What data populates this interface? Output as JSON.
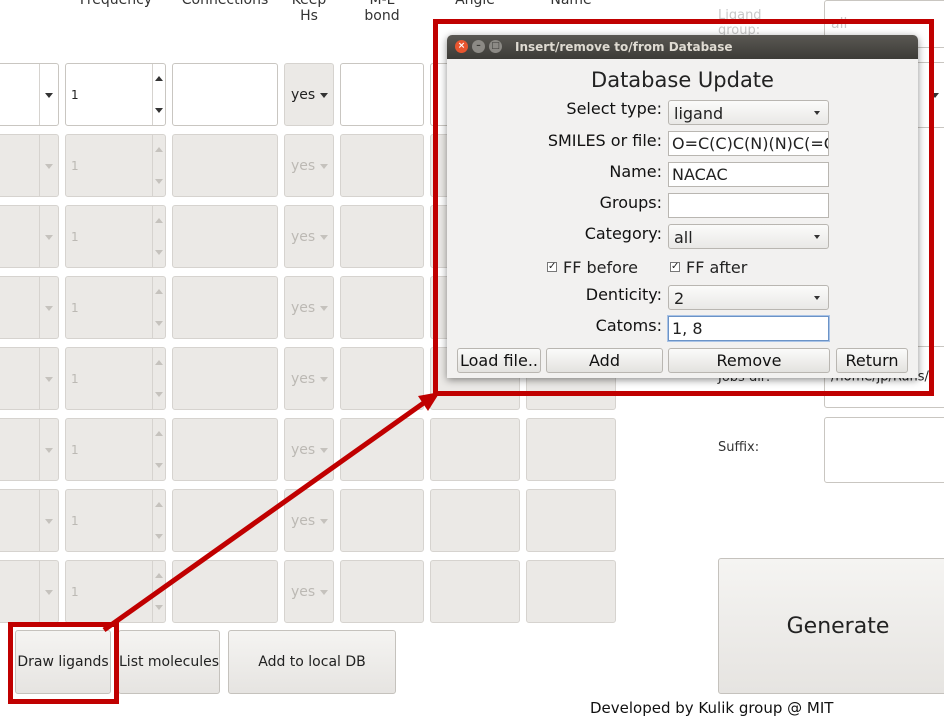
{
  "table": {
    "headers": {
      "frequency": "Frequency",
      "connections": "Connections",
      "keep_hs_line1": "Keep",
      "keep_hs_line2": "Hs",
      "ml_bond_line1": "M-L",
      "ml_bond_line2": "bond",
      "angle": "Angle",
      "name": "Name"
    },
    "rows": [
      {
        "frequency": "1",
        "keep_hs": "yes"
      },
      {
        "frequency": "1",
        "keep_hs": "yes"
      },
      {
        "frequency": "1",
        "keep_hs": "yes"
      },
      {
        "frequency": "1",
        "keep_hs": "yes"
      },
      {
        "frequency": "1",
        "keep_hs": "yes"
      },
      {
        "frequency": "1",
        "keep_hs": "yes"
      },
      {
        "frequency": "1",
        "keep_hs": "yes"
      },
      {
        "frequency": "1",
        "keep_hs": "yes"
      }
    ]
  },
  "right_panel": {
    "ligand_group_label_1": "Ligand",
    "ligand_group_label_2": "group:",
    "ligand_group_value": "all",
    "path_label": "Jobs dir:",
    "path_value": "/home/jp/Runs/",
    "suffix_label": "Suffix:",
    "generate_label": "Generate",
    "footer": "Developed by Kulik group @ MIT"
  },
  "bottom_buttons": {
    "draw_ligands": "Draw ligands",
    "list_molecules": "List molecules",
    "add_to_local_db": "Add to local DB"
  },
  "dialog": {
    "window_title": "Insert/remove to/from Database",
    "heading": "Database Update",
    "select_type_label": "Select type:",
    "select_type_value": "ligand",
    "smiles_label": "SMILES or file:",
    "smiles_value": "O=C(C)C(N)(N)C(=O",
    "name_label": "Name:",
    "name_value": "NACAC",
    "groups_label": "Groups:",
    "groups_value": "",
    "category_label": "Category:",
    "category_value": "all",
    "ff_before_label": "FF before",
    "ff_after_label": "FF after",
    "denticity_label": "Denticity:",
    "denticity_value": "2",
    "catoms_label": "Catoms:",
    "catoms_value": "1, 8",
    "load_file_label": "Load file..",
    "add_label": "Add",
    "remove_label": "Remove",
    "return_label": "Return",
    "close_glyph": "×",
    "minimize_glyph": "–",
    "maximize_glyph": "□",
    "check_glyph": "✓"
  },
  "colors": {
    "highlight_red": "#c00000",
    "titlebar": "#3c3b37",
    "close_button": "#e8552f"
  }
}
